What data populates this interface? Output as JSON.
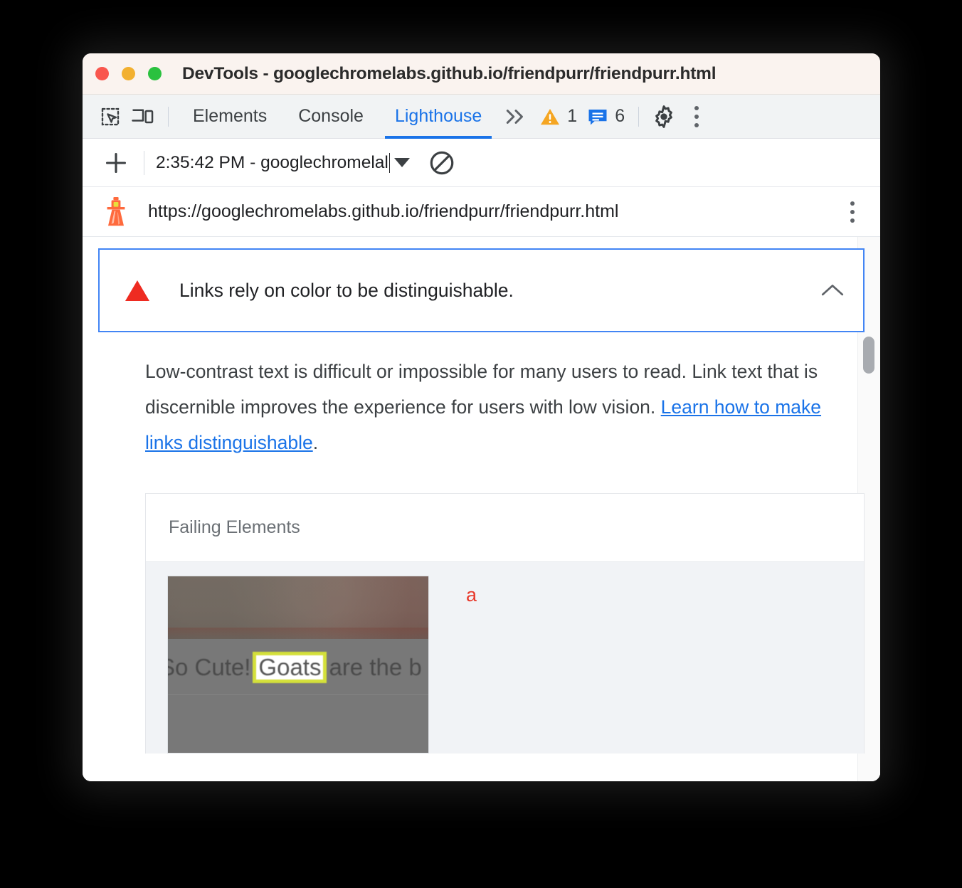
{
  "window": {
    "title": "DevTools - googlechromelabs.github.io/friendpurr/friendpurr.html",
    "traffic_lights": [
      "close",
      "minimize",
      "zoom"
    ],
    "colors": {
      "close": "#f9564d",
      "minimize": "#f2b030",
      "zoom": "#2ac13f",
      "titlebar_bg": "#faf3ef"
    }
  },
  "tabbar": {
    "inspect_icon": "inspect-element-icon",
    "device_icon": "device-toolbar-icon",
    "tabs": [
      {
        "label": "Elements",
        "active": false
      },
      {
        "label": "Console",
        "active": false
      },
      {
        "label": "Lighthouse",
        "active": true
      }
    ],
    "more_tabs_icon": "chevron-double-right-icon",
    "warnings": {
      "icon": "warning-triangle-icon",
      "count": "1",
      "color": "#f5a623"
    },
    "messages": {
      "icon": "message-bubble-icon",
      "count": "6",
      "color": "#1a73e8"
    },
    "settings_icon": "gear-icon",
    "menu_icon": "dots-vertical-icon",
    "active_color": "#1a73e8"
  },
  "lighthouse_toolbar": {
    "new_report_icon": "plus-icon",
    "report_selector_value": "2:35:42 PM - googlechromelal",
    "dropdown_icon": "chevron-down-icon",
    "clear_icon": "clear-circle-slash-icon"
  },
  "target": {
    "icon": "lighthouse-icon",
    "url": "https://googlechromelabs.github.io/friendpurr/friendpurr.html",
    "menu_icon": "dots-vertical-icon"
  },
  "audit": {
    "status_icon": "fail-triangle-icon",
    "status_color": "#ee2b21",
    "title": "Links rely on color to be distinguishable.",
    "collapse_icon": "chevron-up-icon",
    "focus_border_color": "#4285f4",
    "description": {
      "before_link": "Low-contrast text is difficult or impossible for many users to read. Link text that is discernible improves the experience for users with low vision. ",
      "link_text": "Learn how to make links distinguishable",
      "after_link": "."
    }
  },
  "failing_elements": {
    "header": "Failing Elements",
    "rows": [
      {
        "thumbnail": {
          "text_before": "So Cute!",
          "highlight_text": "Goats",
          "text_after": "are the b",
          "highlight_color": "#d4e03a",
          "overlay_color": "#787878"
        },
        "snippet": "a",
        "snippet_color": "#e8382a"
      }
    ]
  },
  "scrollbar": {
    "name": "vertical-scrollbar"
  }
}
